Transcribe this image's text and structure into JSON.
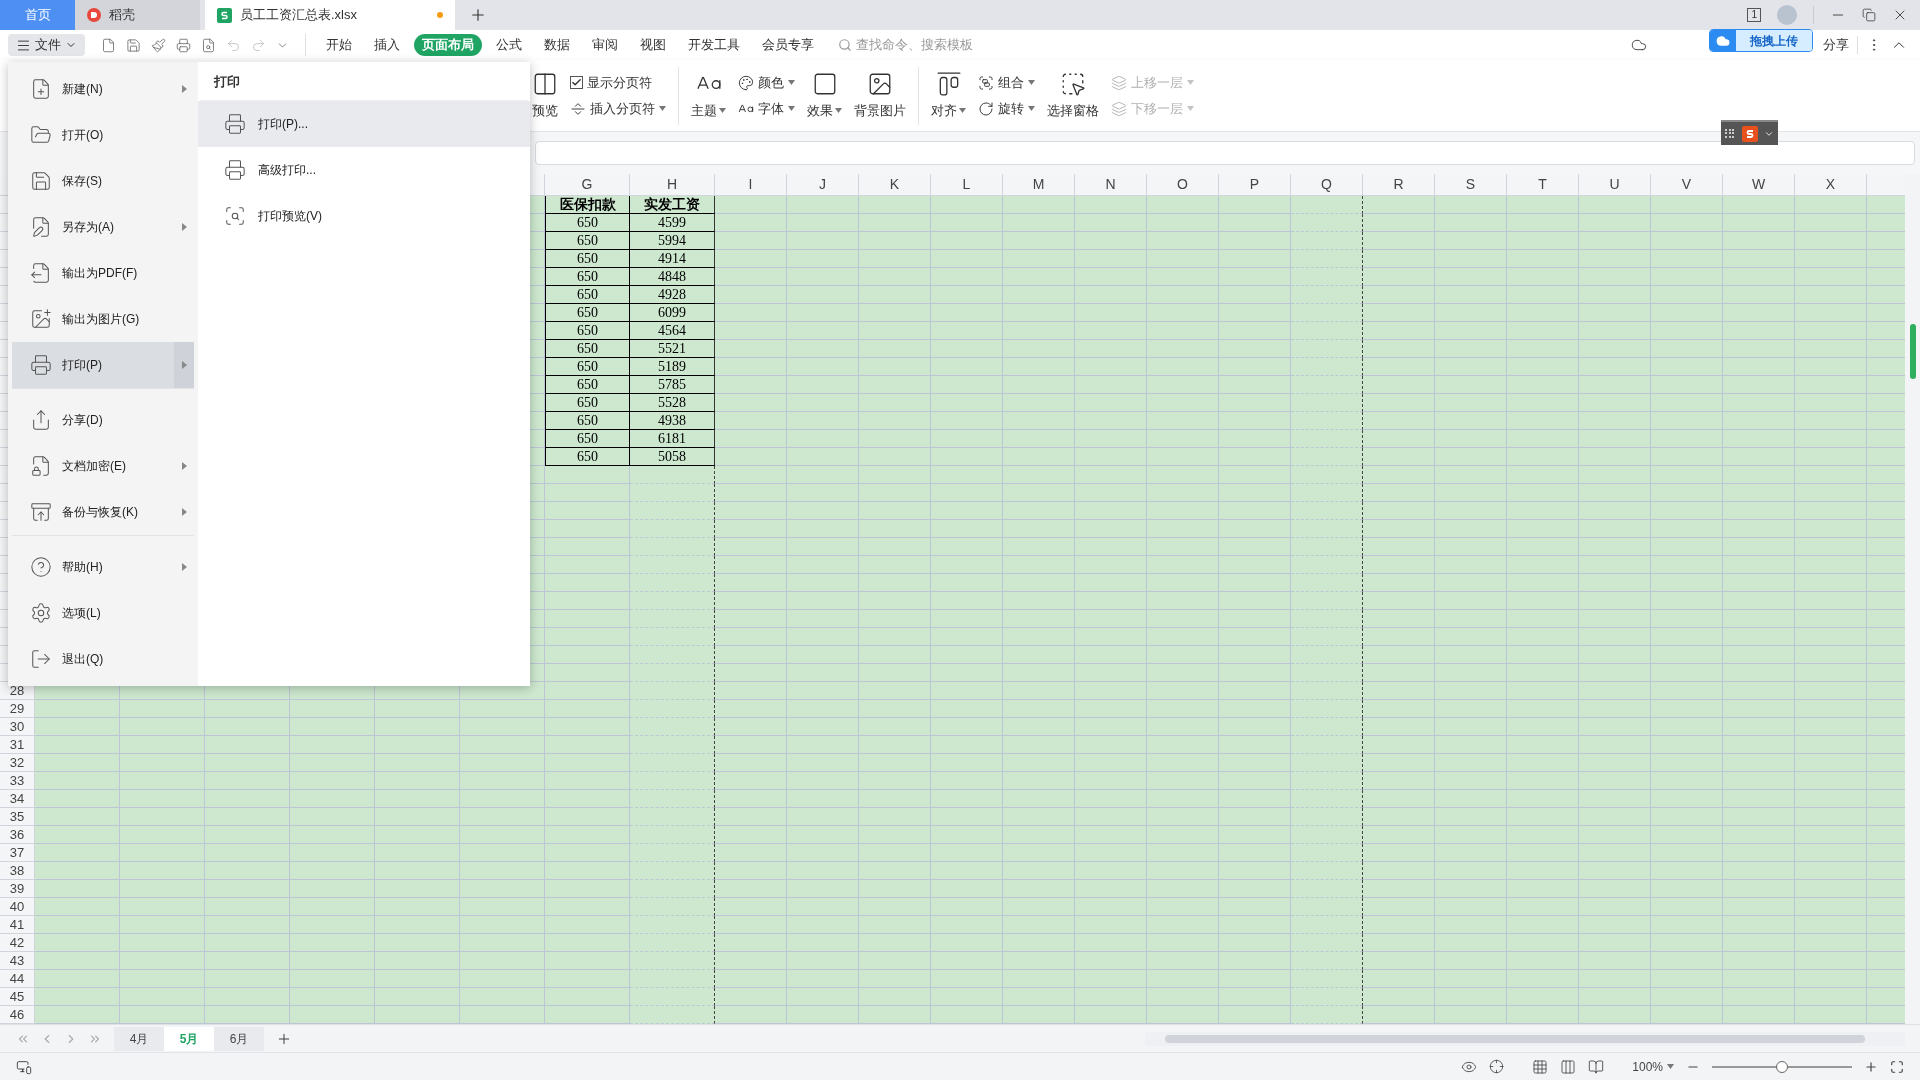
{
  "title_bar": {
    "tabs": [
      {
        "label": "首页",
        "kind": "home",
        "selected": false,
        "modified": false
      },
      {
        "label": "稻壳",
        "kind": "docer",
        "selected": false,
        "modified": false
      },
      {
        "label": "员工工资汇总表.xlsx",
        "kind": "sheet",
        "selected": true,
        "modified": true
      }
    ],
    "window_count": "1"
  },
  "upload_badge": "拖拽上传",
  "toolbar": {
    "file_menu": "文件",
    "menu_tabs": [
      {
        "label": "开始",
        "selected": false
      },
      {
        "label": "插入",
        "selected": false
      },
      {
        "label": "页面布局",
        "selected": true
      },
      {
        "label": "公式",
        "selected": false
      },
      {
        "label": "数据",
        "selected": false
      },
      {
        "label": "审阅",
        "selected": false
      },
      {
        "label": "视图",
        "selected": false
      },
      {
        "label": "开发工具",
        "selected": false
      },
      {
        "label": "会员专享",
        "selected": false
      }
    ],
    "search": {
      "placeholder": "查找命令、搜索模板"
    },
    "share": "分享"
  },
  "ribbon": [
    [
      {
        "kind": "large",
        "label": "预览",
        "dropdown": false,
        "disabled": false
      },
      {
        "kind": "stack",
        "items": [
          {
            "kind": "checkbox",
            "label": "显示分页符",
            "checked": true,
            "dropdown": false,
            "disabled": false
          },
          {
            "kind": "small",
            "label": "插入分页符",
            "dropdown": true,
            "disabled": false
          }
        ]
      }
    ],
    [
      {
        "kind": "large",
        "label": "主题",
        "dropdown": true,
        "disabled": false
      },
      {
        "kind": "stack",
        "items": [
          {
            "kind": "small",
            "label": "颜色",
            "dropdown": true,
            "disabled": false
          },
          {
            "kind": "small",
            "label": "字体",
            "dropdown": true,
            "disabled": false
          }
        ]
      },
      {
        "kind": "large",
        "label": "效果",
        "dropdown": true,
        "disabled": false
      },
      {
        "kind": "large",
        "label": "背景图片",
        "dropdown": false,
        "disabled": false
      }
    ],
    [
      {
        "kind": "large",
        "label": "对齐",
        "dropdown": true,
        "disabled": false
      },
      {
        "kind": "stack",
        "items": [
          {
            "kind": "small",
            "label": "组合",
            "dropdown": true,
            "disabled": false
          },
          {
            "kind": "small",
            "label": "旋转",
            "dropdown": true,
            "disabled": false
          }
        ]
      },
      {
        "kind": "large",
        "label": "选择窗格",
        "dropdown": false,
        "disabled": false
      },
      {
        "kind": "stack",
        "items": [
          {
            "kind": "small",
            "label": "上移一层",
            "dropdown": true,
            "disabled": true
          },
          {
            "kind": "small",
            "label": "下移一层",
            "dropdown": true,
            "disabled": true
          }
        ]
      }
    ]
  ],
  "file_menu": {
    "items": [
      {
        "label": "新建(N)",
        "submenu": true,
        "selected": false,
        "divider_before": false
      },
      {
        "label": "打开(O)",
        "submenu": false,
        "selected": false,
        "divider_before": false
      },
      {
        "label": "保存(S)",
        "submenu": false,
        "selected": false,
        "divider_before": false
      },
      {
        "label": "另存为(A)",
        "submenu": true,
        "selected": false,
        "divider_before": false
      },
      {
        "label": "输出为PDF(F)",
        "submenu": false,
        "selected": false,
        "divider_before": false
      },
      {
        "label": "输出为图片(G)",
        "submenu": false,
        "selected": false,
        "divider_before": false
      },
      {
        "label": "打印(P)",
        "submenu": true,
        "selected": true,
        "divider_before": false
      },
      {
        "label": "分享(D)",
        "submenu": false,
        "selected": false,
        "divider_before": true
      },
      {
        "label": "文档加密(E)",
        "submenu": true,
        "selected": false,
        "divider_before": false
      },
      {
        "label": "备份与恢复(K)",
        "submenu": true,
        "selected": false,
        "divider_before": false
      },
      {
        "label": "帮助(H)",
        "submenu": true,
        "selected": false,
        "divider_before": true
      },
      {
        "label": "选项(L)",
        "submenu": false,
        "selected": false,
        "divider_before": false
      },
      {
        "label": "退出(Q)",
        "submenu": false,
        "selected": false,
        "divider_before": false
      }
    ],
    "submenu": {
      "title": "打印",
      "items": [
        {
          "label": "打印(P)...",
          "selected": true
        },
        {
          "label": "高级打印...",
          "selected": false
        },
        {
          "label": "打印预览(V)",
          "selected": false
        }
      ]
    }
  },
  "sheet": {
    "columns": [
      "G",
      "H",
      "I",
      "J",
      "K",
      "L",
      "M",
      "N",
      "O",
      "P",
      "Q",
      "R",
      "S",
      "T",
      "U",
      "V",
      "W",
      "X"
    ],
    "row_numbers": [
      "28",
      "29",
      "30",
      "31",
      "32",
      "33",
      "34",
      "35",
      "36",
      "37",
      "38",
      "39",
      "40",
      "41",
      "42",
      "43",
      "44",
      "45",
      "46"
    ],
    "header": [
      "医保扣款",
      "实发工资"
    ],
    "rows": [
      [
        "650",
        "4599"
      ],
      [
        "650",
        "5994"
      ],
      [
        "650",
        "4914"
      ],
      [
        "650",
        "4848"
      ],
      [
        "650",
        "4928"
      ],
      [
        "650",
        "6099"
      ],
      [
        "650",
        "4564"
      ],
      [
        "650",
        "5521"
      ],
      [
        "650",
        "5189"
      ],
      [
        "650",
        "5785"
      ],
      [
        "650",
        "5528"
      ],
      [
        "650",
        "4938"
      ],
      [
        "650",
        "6181"
      ],
      [
        "650",
        "5058"
      ]
    ]
  },
  "sheet_tabs": [
    {
      "label": "4月",
      "selected": false
    },
    {
      "label": "5月",
      "selected": true
    },
    {
      "label": "6月",
      "selected": false
    }
  ],
  "status_bar": {
    "zoom": "100%",
    "zoom_slider": {
      "level": 0.5
    }
  }
}
